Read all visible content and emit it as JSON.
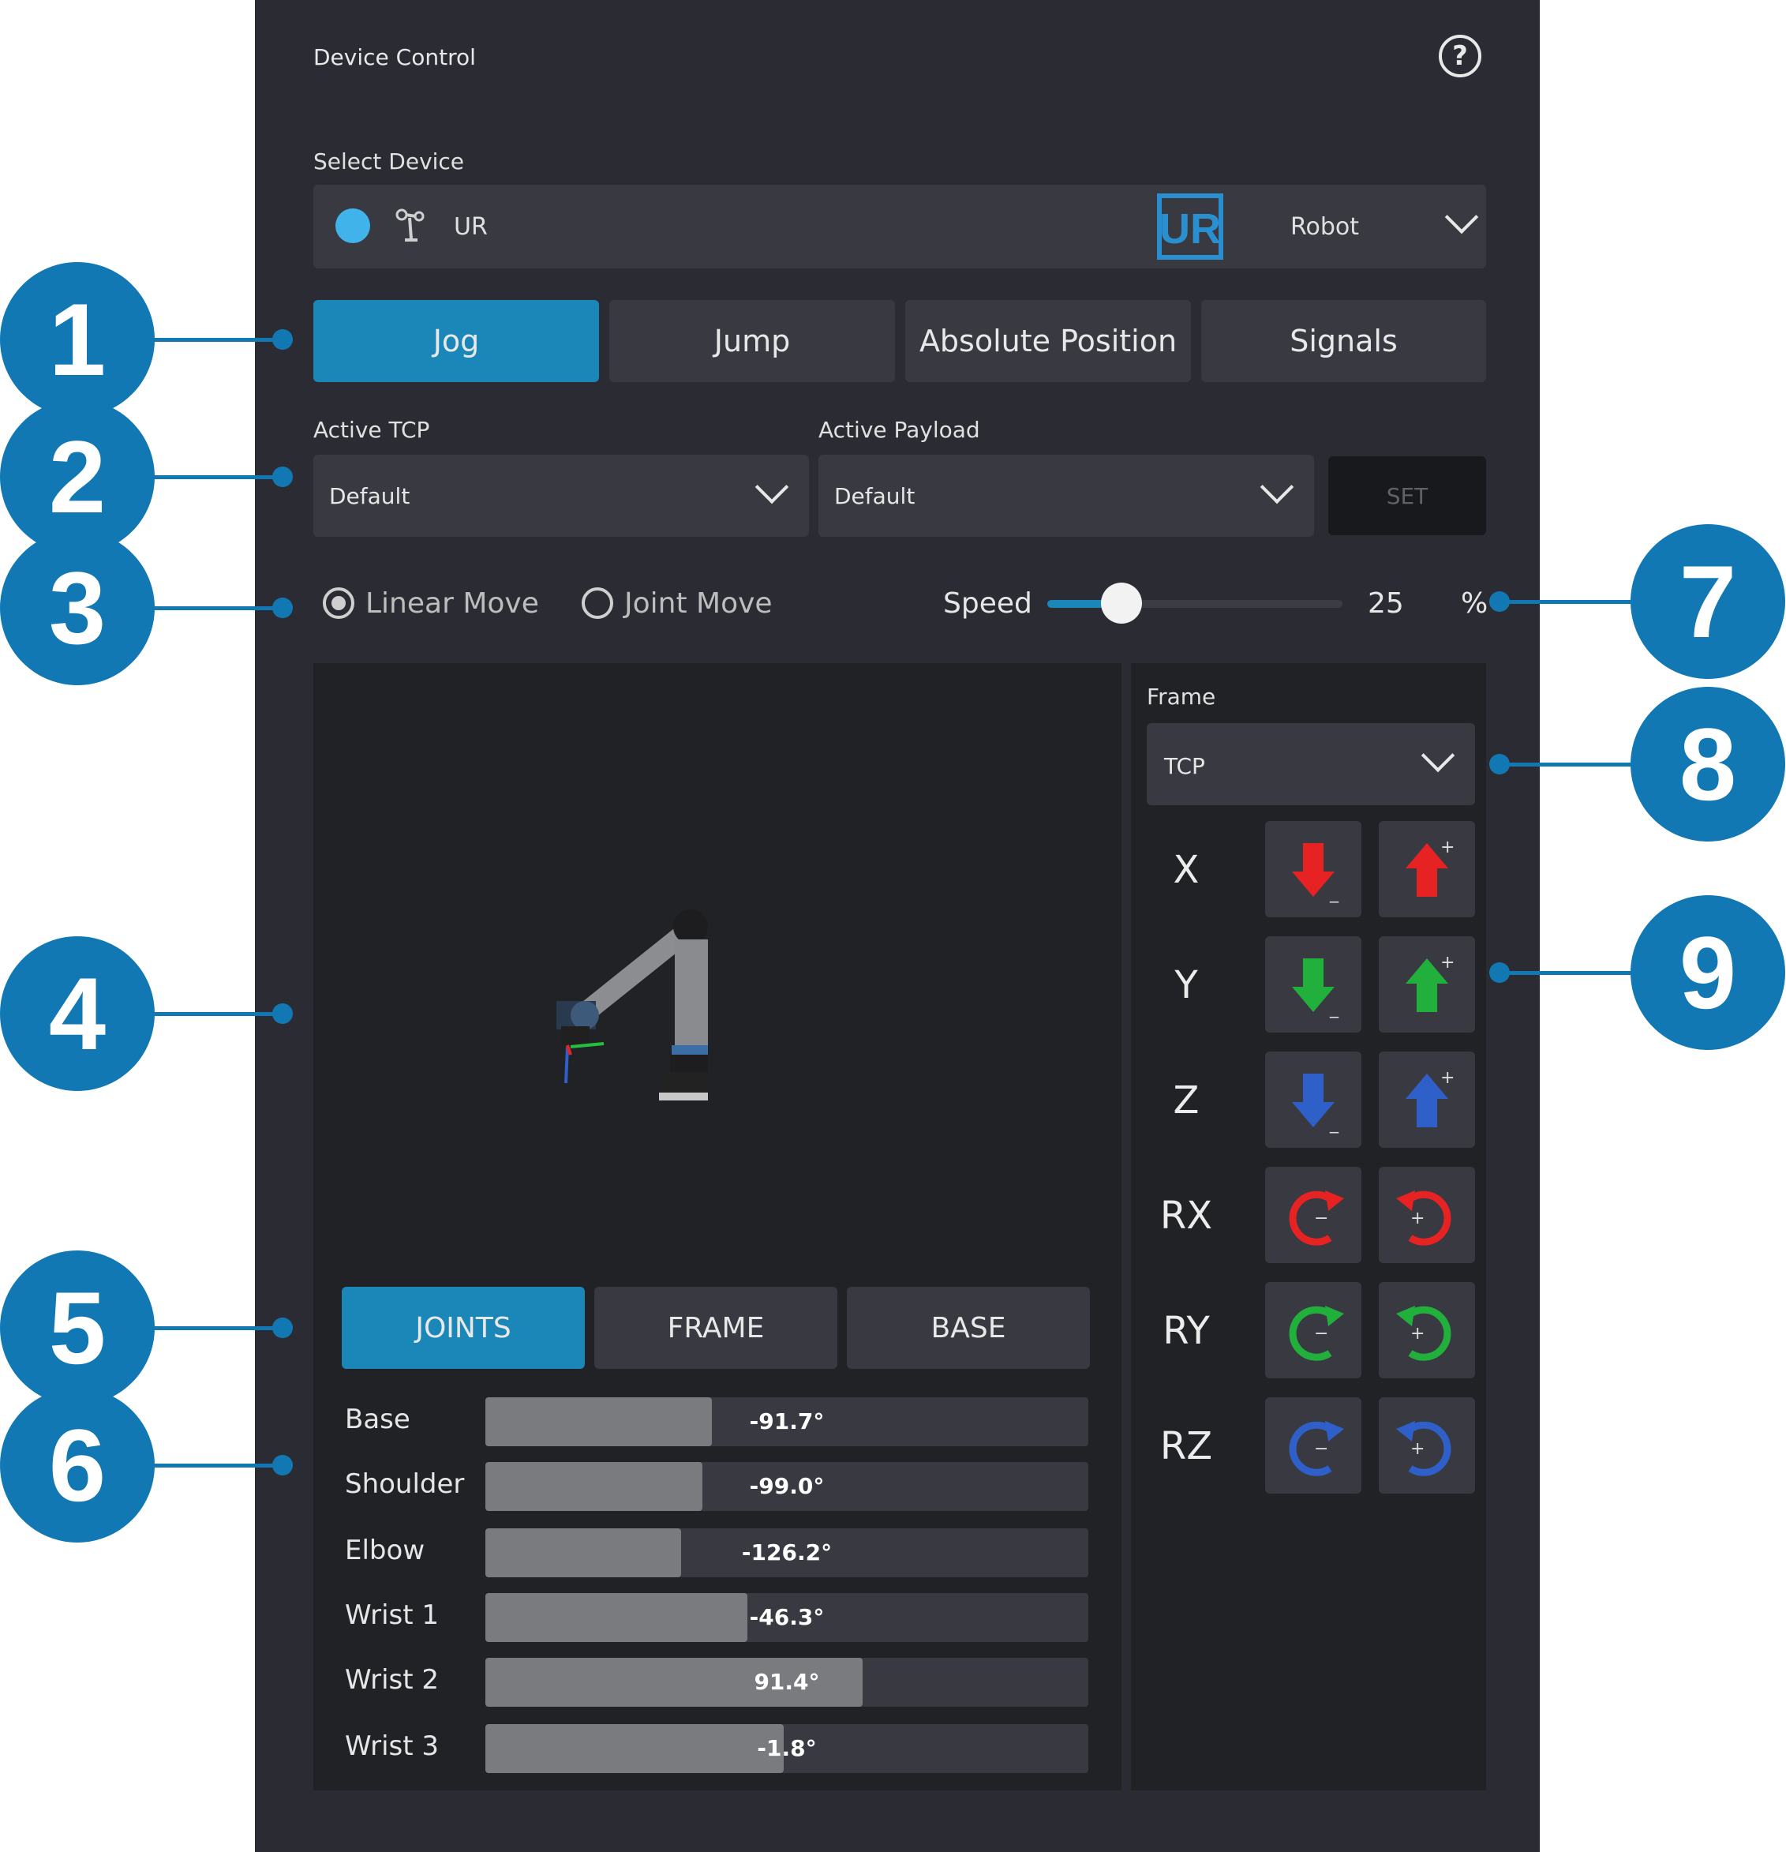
{
  "header": {
    "title": "Device Control",
    "help_icon": "question-circle-icon"
  },
  "device": {
    "label": "Select Device",
    "name": "UR",
    "logo_text": "UR",
    "type": "Robot",
    "status_color": "#3fb3ea"
  },
  "tabs": [
    {
      "label": "Jog",
      "active": true
    },
    {
      "label": "Jump",
      "active": false
    },
    {
      "label": "Absolute Position",
      "active": false
    },
    {
      "label": "Signals",
      "active": false
    }
  ],
  "tcp": {
    "label": "Active TCP",
    "value": "Default"
  },
  "payload": {
    "label": "Active Payload",
    "value": "Default"
  },
  "set_button": "SET",
  "move_mode": {
    "linear": "Linear Move",
    "joint": "Joint Move",
    "selected": "Linear Move"
  },
  "speed": {
    "label": "Speed",
    "value": "25",
    "unit": "%",
    "fraction": 0.25
  },
  "joint_tabs": [
    {
      "label": "JOINTS",
      "active": true
    },
    {
      "label": "FRAME",
      "active": false
    },
    {
      "label": "BASE",
      "active": false
    }
  ],
  "joints": [
    {
      "name": "Base",
      "value": "-91.7°",
      "fill": 0.375
    },
    {
      "name": "Shoulder",
      "value": "-99.0°",
      "fill": 0.36
    },
    {
      "name": "Elbow",
      "value": "-126.2°",
      "fill": 0.325
    },
    {
      "name": "Wrist 1",
      "value": "-46.3°",
      "fill": 0.435
    },
    {
      "name": "Wrist 2",
      "value": "91.4°",
      "fill": 0.625
    },
    {
      "name": "Wrist 3",
      "value": "-1.8°",
      "fill": 0.495
    }
  ],
  "frame": {
    "label": "Frame",
    "value": "TCP"
  },
  "axes": [
    {
      "label": "X",
      "color": "#e62222",
      "kind": "linear"
    },
    {
      "label": "Y",
      "color": "#22b03c",
      "kind": "linear"
    },
    {
      "label": "Z",
      "color": "#2f5fc8",
      "kind": "linear"
    },
    {
      "label": "RX",
      "color": "#e62222",
      "kind": "rotary"
    },
    {
      "label": "RY",
      "color": "#22b03c",
      "kind": "rotary"
    },
    {
      "label": "RZ",
      "color": "#2f5fc8",
      "kind": "rotary"
    }
  ],
  "callouts": [
    "1",
    "2",
    "3",
    "4",
    "5",
    "6",
    "7",
    "8",
    "9"
  ],
  "colors": {
    "accent": "#1a87b8",
    "callout": "#1278b4",
    "panel": "#2b2c33"
  }
}
